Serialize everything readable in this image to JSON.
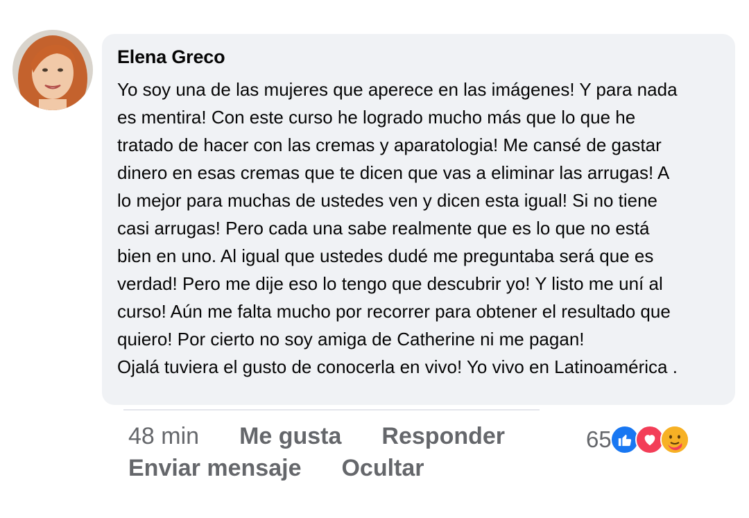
{
  "comment": {
    "author": "Elena Greco",
    "text_lines": [
      "Yo soy una de las mujeres que aperece en las imágenes! Y para nada",
      "es mentira! Con este curso he logrado mucho más que lo que he",
      "tratado de hacer con las cremas y aparatologia! Me cansé de gastar",
      "dinero en esas cremas que te dicen que vas a eliminar las arrugas! A",
      "lo mejor para muchas de ustedes ven y dicen esta igual! Si no tiene",
      "casi arrugas! Pero cada una sabe realmente que es lo que no está",
      "bien en uno. Al igual que ustedes dudé me preguntaba será que es",
      "verdad! Pero me dije eso lo tengo que descubrir yo! Y listo me uní al",
      "curso! Aún me falta mucho por recorrer para obtener el resultado que",
      "quiero! Por cierto no soy amiga de Catherine ni me pagan!",
      "Ojalá tuviera el gusto de conocerla en vivo! Yo vivo en Latinoamérica ."
    ]
  },
  "actions": {
    "timestamp": "48 min",
    "like_label": "Me gusta",
    "reply_label": "Responder",
    "message_label": "Enviar mensaje",
    "hide_label": "Ocultar"
  },
  "reactions": {
    "count": "65",
    "icons": [
      "like-icon",
      "love-icon",
      "care-icon"
    ]
  },
  "colors": {
    "bubble_bg": "#f0f2f5",
    "text": "#050505",
    "secondary_text": "#65676b",
    "like": "#1877f2",
    "love": "#f33e58",
    "care": "#f7b125"
  }
}
